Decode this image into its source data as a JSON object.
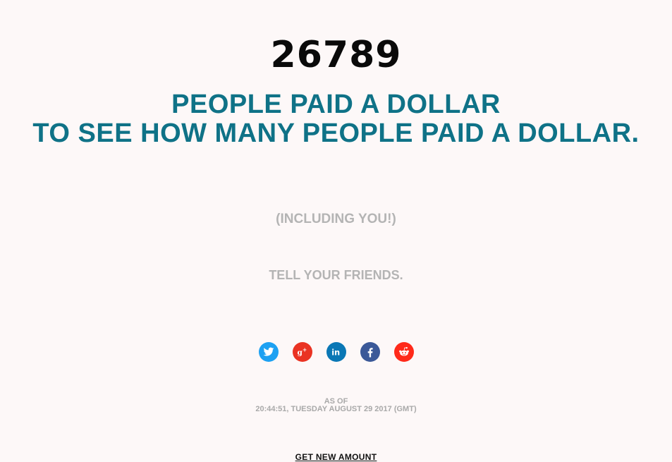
{
  "counter": {
    "value": "26789"
  },
  "headline": {
    "line1": "PEOPLE PAID A DOLLAR",
    "line2": "TO SEE HOW MANY PEOPLE PAID A DOLLAR."
  },
  "including_text": "(INCLUDING YOU!)",
  "tell_text": "TELL YOUR FRIENDS.",
  "share": {
    "items": [
      {
        "name": "twitter",
        "icon": "twitter-icon",
        "color": "#1da1f2"
      },
      {
        "name": "google-plus",
        "icon": "google-plus-icon",
        "color": "#ea3323"
      },
      {
        "name": "linkedin",
        "icon": "linkedin-icon",
        "color": "#0a77b5"
      },
      {
        "name": "facebook",
        "icon": "facebook-icon",
        "color": "#3b5998"
      },
      {
        "name": "reddit",
        "icon": "reddit-icon",
        "color": "#ff2a1a"
      }
    ]
  },
  "as_of": {
    "label": "AS OF",
    "timestamp": "20:44:51, TUESDAY AUGUST 29 2017 (GMT)"
  },
  "get_new_amount": "GET NEW AMOUNT",
  "colors": {
    "background": "#fdf8f8",
    "headline": "#0f7287",
    "muted": "#b4b4b4",
    "counter": "#0a0a0a"
  }
}
